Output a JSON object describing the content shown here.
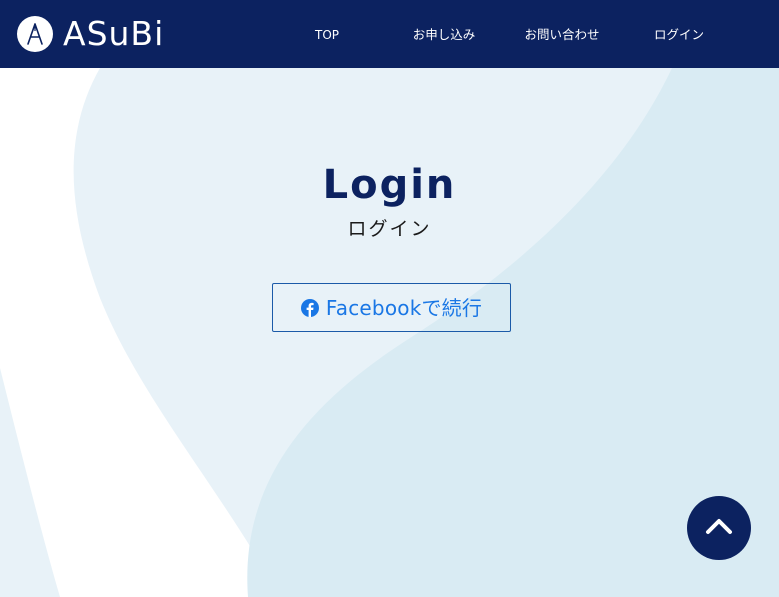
{
  "header": {
    "logo_text": "ASuBi",
    "nav": {
      "top": "TOP",
      "apply": "お申し込み",
      "contact": "お問い合わせ",
      "login": "ログイン"
    }
  },
  "main": {
    "title": "Login",
    "subtitle": "ログイン",
    "facebook_button": {
      "icon": "facebook-icon",
      "label": "Facebookで続行"
    }
  },
  "scroll_top": {
    "icon": "chevron-up-icon"
  },
  "colors": {
    "header_bg": "#0c2260",
    "title": "#0c2260",
    "facebook_blue": "#1a77e5",
    "bg_light": "#e8f2f8",
    "bg_shape": "#d8eaf2"
  }
}
